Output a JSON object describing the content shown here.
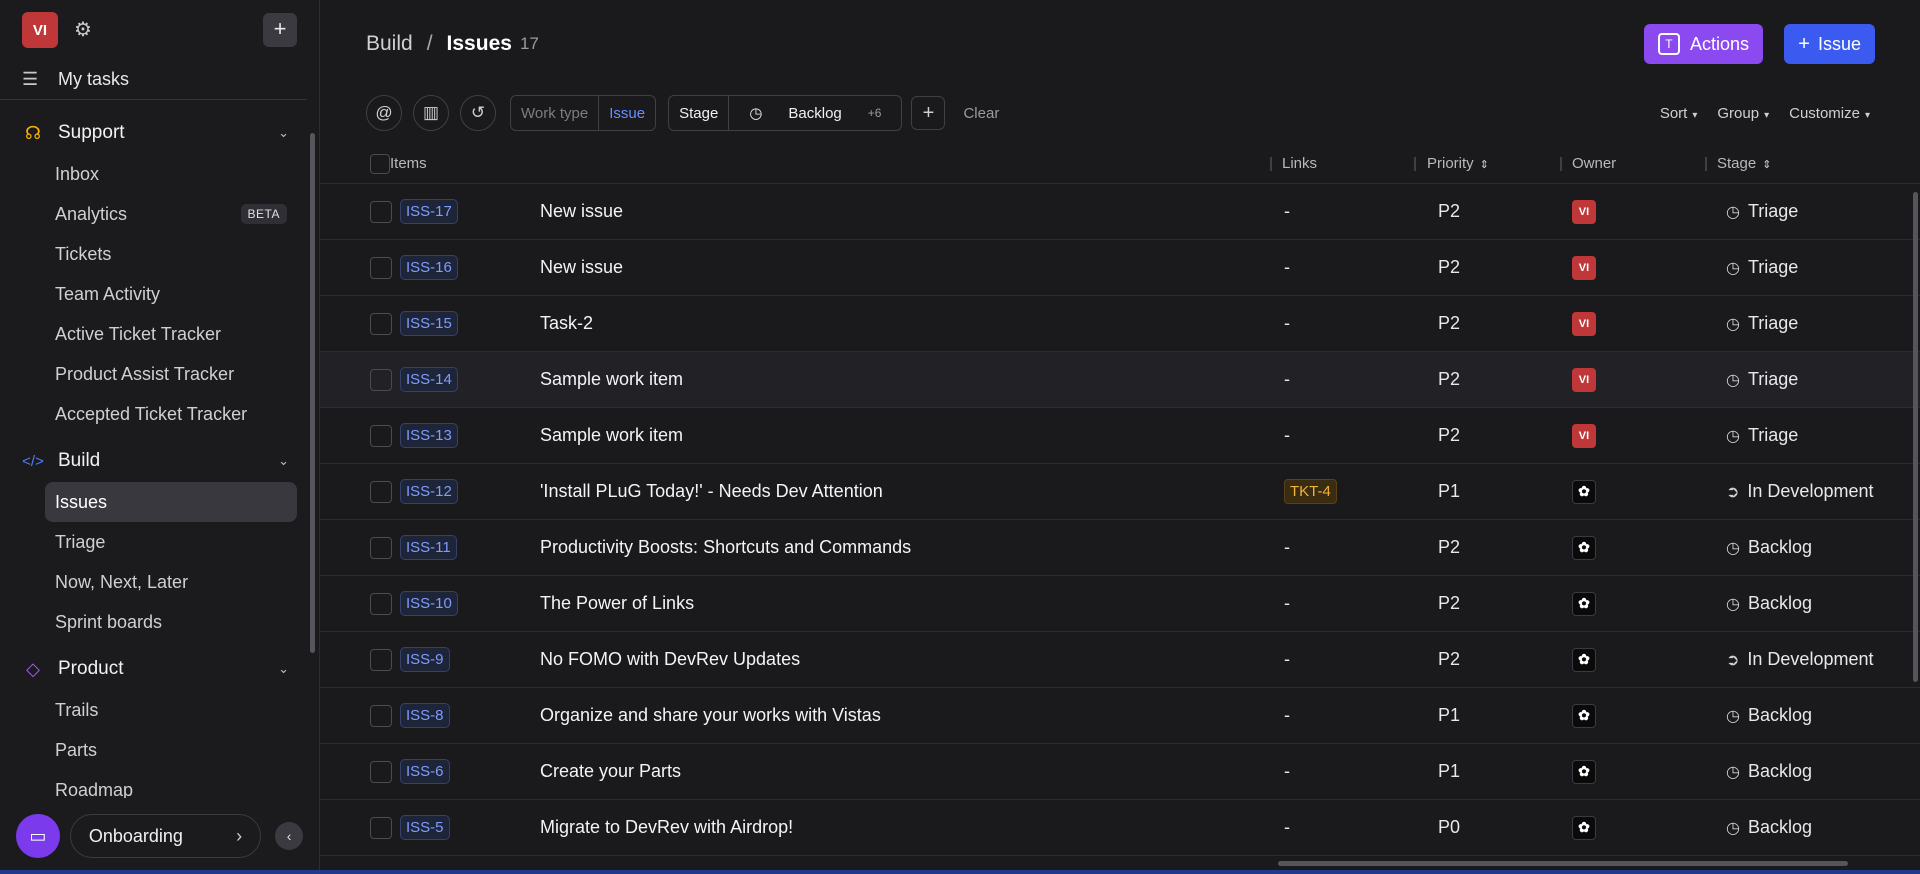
{
  "sidebar": {
    "avatar": "VI",
    "my_tasks": "My tasks",
    "sections": [
      {
        "label": "Support",
        "items": [
          "Inbox",
          "Analytics",
          "Tickets",
          "Team Activity",
          "Active Ticket Tracker",
          "Product Assist Tracker",
          "Accepted Ticket Tracker"
        ]
      },
      {
        "label": "Build",
        "items": [
          "Issues",
          "Triage",
          "Now, Next, Later",
          "Sprint boards"
        ]
      },
      {
        "label": "Product",
        "items": [
          "Trails",
          "Parts",
          "Roadmap"
        ]
      }
    ],
    "beta": "BETA",
    "onboarding": "Onboarding"
  },
  "header": {
    "crumb_parent": "Build",
    "crumb_sep": "/",
    "crumb_current": "Issues",
    "count": "17",
    "actions_label": "Actions",
    "issue_label": "Issue"
  },
  "filters": {
    "work_type_label": "Work type",
    "work_type_value": "Issue",
    "stage_label": "Stage",
    "stage_value": "Backlog",
    "stage_more": "+6",
    "clear": "Clear",
    "sort": "Sort",
    "group": "Group",
    "customize": "Customize"
  },
  "columns": {
    "items": "Items",
    "links": "Links",
    "priority": "Priority",
    "owner": "Owner",
    "stage": "Stage"
  },
  "rows": [
    {
      "id": "ISS-17",
      "title": "New issue",
      "links": "-",
      "priority": "P2",
      "owner": "VI",
      "stage": "Triage"
    },
    {
      "id": "ISS-16",
      "title": "New issue",
      "links": "-",
      "priority": "P2",
      "owner": "VI",
      "stage": "Triage"
    },
    {
      "id": "ISS-15",
      "title": "Task-2",
      "links": "-",
      "priority": "P2",
      "owner": "VI",
      "stage": "Triage"
    },
    {
      "id": "ISS-14",
      "title": "Sample work item",
      "links": "-",
      "priority": "P2",
      "owner": "VI",
      "stage": "Triage"
    },
    {
      "id": "ISS-13",
      "title": "Sample work item",
      "links": "-",
      "priority": "P2",
      "owner": "VI",
      "stage": "Triage"
    },
    {
      "id": "ISS-12",
      "title": "'Install PLuG Today!' - Needs Dev Attention",
      "links": "TKT-4",
      "priority": "P1",
      "owner": "",
      "stage": "In Development"
    },
    {
      "id": "ISS-11",
      "title": "Productivity Boosts: Shortcuts and Commands",
      "links": "-",
      "priority": "P2",
      "owner": "",
      "stage": "Backlog"
    },
    {
      "id": "ISS-10",
      "title": "The Power of Links",
      "links": "-",
      "priority": "P2",
      "owner": "",
      "stage": "Backlog"
    },
    {
      "id": "ISS-9",
      "title": "No FOMO with DevRev Updates",
      "links": "-",
      "priority": "P2",
      "owner": "",
      "stage": "In Development"
    },
    {
      "id": "ISS-8",
      "title": "Organize and share your works with Vistas",
      "links": "-",
      "priority": "P1",
      "owner": "",
      "stage": "Backlog"
    },
    {
      "id": "ISS-6",
      "title": "Create your Parts",
      "links": "-",
      "priority": "P1",
      "owner": "",
      "stage": "Backlog"
    },
    {
      "id": "ISS-5",
      "title": "Migrate to DevRev with Airdrop!",
      "links": "-",
      "priority": "P0",
      "owner": "",
      "stage": "Backlog"
    }
  ]
}
